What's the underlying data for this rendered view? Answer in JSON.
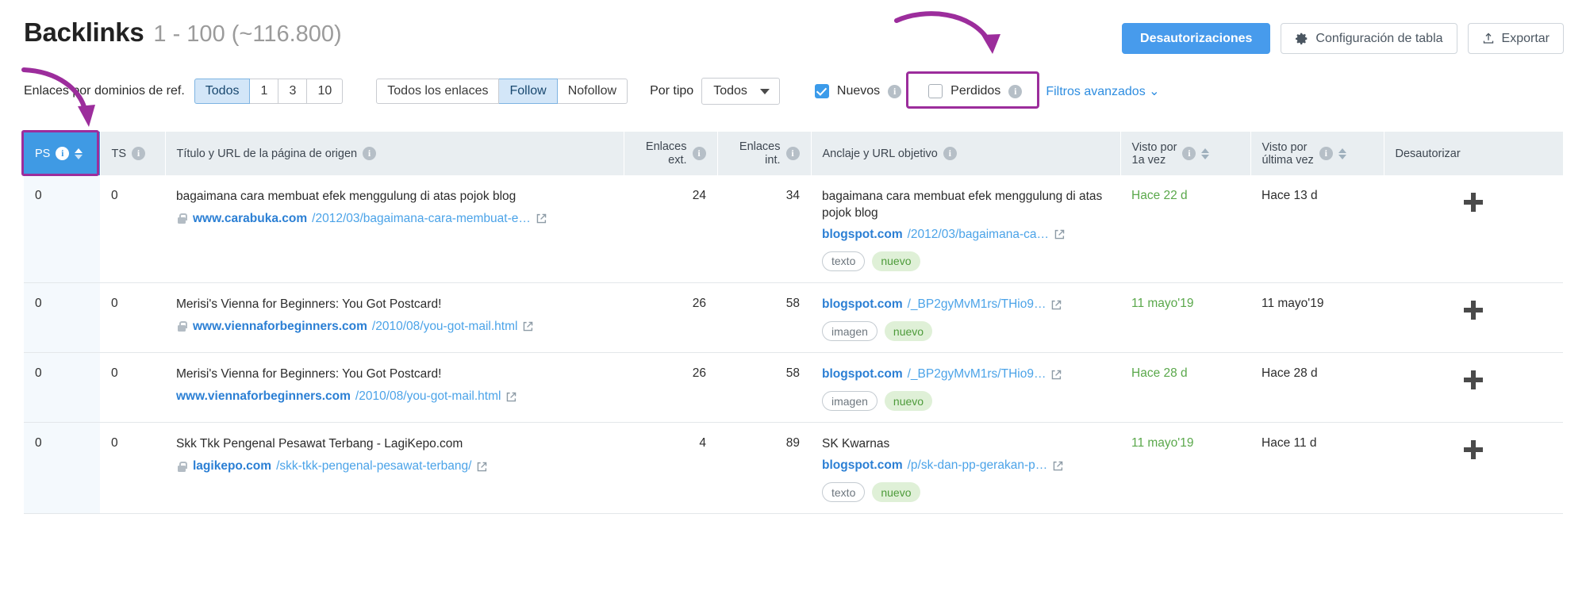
{
  "header": {
    "title": "Backlinks",
    "range": "1 - 100 (~116.800)",
    "buttons": {
      "disavows": "Desautorizaciones",
      "table_settings": "Configuración de tabla",
      "settings_icon": "gear-icon",
      "export": "Exportar",
      "export_icon": "upload-icon"
    }
  },
  "filters": {
    "ref_domains_label": "Enlaces por dominios de ref.",
    "ref_domains_options": [
      "Todos",
      "1",
      "3",
      "10"
    ],
    "ref_domains_selected": "Todos",
    "link_type_options": [
      "Todos los enlaces",
      "Follow",
      "Nofollow"
    ],
    "link_type_selected": "Follow",
    "by_type_label": "Por tipo",
    "by_type_value": "Todos",
    "new_label": "Nuevos",
    "new_checked": true,
    "lost_label": "Perdidos",
    "lost_checked": false,
    "advanced_label": "Filtros avanzados"
  },
  "table": {
    "columns": [
      {
        "key": "ps",
        "label": "PS",
        "info": true,
        "sortable": true,
        "active": true,
        "align": "left"
      },
      {
        "key": "ts",
        "label": "TS",
        "info": true,
        "sortable": false,
        "align": "left"
      },
      {
        "key": "source",
        "label": "Título y URL de la página de origen",
        "info": true,
        "sortable": false,
        "align": "left"
      },
      {
        "key": "ext",
        "label": "Enlaces\next.",
        "label_l1": "Enlaces",
        "label_l2": "ext.",
        "info": true,
        "sortable": false,
        "align": "right"
      },
      {
        "key": "int",
        "label": "Enlaces\nint.",
        "label_l1": "Enlaces",
        "label_l2": "int.",
        "info": true,
        "sortable": false,
        "align": "right"
      },
      {
        "key": "anchor",
        "label": "Anclaje y URL objetivo",
        "info": true,
        "sortable": false,
        "align": "left"
      },
      {
        "key": "first_seen",
        "label_l1": "Visto por",
        "label_l2": "1a vez",
        "info": true,
        "sortable": true,
        "align": "left"
      },
      {
        "key": "last_seen",
        "label_l1": "Visto por",
        "label_l2": "última vez",
        "info": true,
        "sortable": true,
        "align": "left"
      },
      {
        "key": "disavow",
        "label": "Desautorizar",
        "info": false,
        "sortable": false,
        "align": "left"
      }
    ],
    "rows": [
      {
        "ps": "0",
        "ts": "0",
        "source_title": "bagaimana cara membuat efek menggulung di atas pojok blog",
        "source_lock": true,
        "source_domain": "www.carabuka.com",
        "source_path": "/2012/03/bagaimana-cara-membuat-e…",
        "ext": "24",
        "int": "34",
        "anchor_text": "bagaimana cara membuat efek menggulung di atas pojok blog",
        "target_domain": "blogspot.com",
        "target_path": "/2012/03/bagaimana-ca…",
        "tags": [
          {
            "label": "texto",
            "style": "gray"
          },
          {
            "label": "nuevo",
            "style": "green"
          }
        ],
        "first_seen": "Hace 22 d",
        "last_seen": "Hace 13 d",
        "disavow_icon": "plus-icon"
      },
      {
        "ps": "0",
        "ts": "0",
        "source_title": "Merisi's Vienna for Beginners: You Got Postcard!",
        "source_lock": true,
        "source_domain": "www.viennaforbeginners.com",
        "source_path": "/2010/08/you-got-mail.html",
        "ext": "26",
        "int": "58",
        "anchor_text": "",
        "target_domain": "blogspot.com",
        "target_path": "/_BP2gyMvM1rs/THio9…",
        "tags": [
          {
            "label": "imagen",
            "style": "gray"
          },
          {
            "label": "nuevo",
            "style": "green"
          }
        ],
        "first_seen": "11 mayo'19",
        "last_seen": "11 mayo'19",
        "disavow_icon": "plus-icon"
      },
      {
        "ps": "0",
        "ts": "0",
        "source_title": "Merisi's Vienna for Beginners: You Got Postcard!",
        "source_lock": false,
        "source_domain": "www.viennaforbeginners.com",
        "source_path": "/2010/08/you-got-mail.html",
        "ext": "26",
        "int": "58",
        "anchor_text": "",
        "target_domain": "blogspot.com",
        "target_path": "/_BP2gyMvM1rs/THio9…",
        "tags": [
          {
            "label": "imagen",
            "style": "gray"
          },
          {
            "label": "nuevo",
            "style": "green"
          }
        ],
        "first_seen": "Hace 28 d",
        "last_seen": "Hace 28 d",
        "disavow_icon": "plus-icon"
      },
      {
        "ps": "0",
        "ts": "0",
        "source_title": "Skk Tkk Pengenal Pesawat Terbang - LagiKepo.com",
        "source_lock": true,
        "source_domain": "lagikepo.com",
        "source_path": "/skk-tkk-pengenal-pesawat-terbang/",
        "ext": "4",
        "int": "89",
        "anchor_text": "SK Kwarnas",
        "target_domain": "blogspot.com",
        "target_path": "/p/sk-dan-pp-gerakan-p…",
        "tags": [
          {
            "label": "texto",
            "style": "gray"
          },
          {
            "label": "nuevo",
            "style": "green"
          }
        ],
        "first_seen": "11 mayo'19",
        "last_seen": "Hace 11 d",
        "disavow_icon": "plus-icon"
      }
    ]
  },
  "annotations": {
    "arrow_to_ps": "curved-arrow-icon",
    "arrow_to_nuevos": "curved-arrow-icon",
    "highlight_color": "#9c2d9c"
  },
  "colors": {
    "accent_blue": "#479bec",
    "header_blue": "#3f9ae4",
    "link_blue": "#2b7fd4",
    "green": "#5aa84b",
    "purple": "#9c2d9c"
  }
}
